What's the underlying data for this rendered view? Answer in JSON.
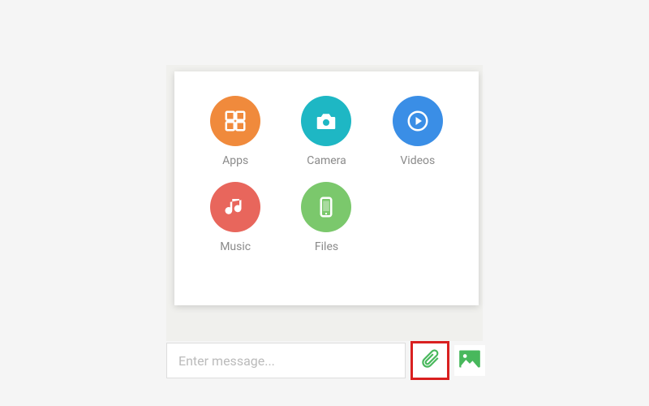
{
  "attach_panel": {
    "items": [
      {
        "label": "Apps",
        "icon": "apps-grid-icon",
        "color": "#f08a3c"
      },
      {
        "label": "Camera",
        "icon": "camera-icon",
        "color": "#1eb7c4"
      },
      {
        "label": "Videos",
        "icon": "play-icon",
        "color": "#3a8ee6"
      },
      {
        "label": "Music",
        "icon": "music-note-icon",
        "color": "#e8665c"
      },
      {
        "label": "Files",
        "icon": "phone-icon",
        "color": "#7bc86c"
      }
    ]
  },
  "compose": {
    "placeholder": "Enter message...",
    "attach_highlight_color": "#d92020",
    "accent_color": "#48b85c"
  }
}
